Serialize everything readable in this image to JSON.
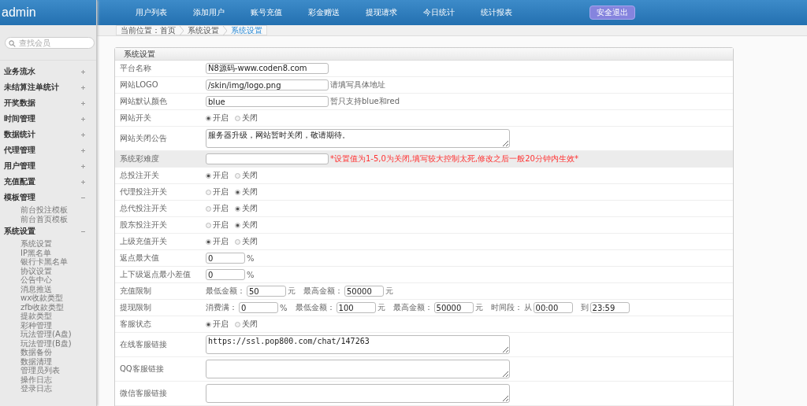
{
  "header": {
    "brand": "admin",
    "nav": [
      "用户列表",
      "添加用户",
      "账号充值",
      "彩金赠送",
      "提现请求",
      "今日统计",
      "统计报表"
    ],
    "logout": "安全退出"
  },
  "breadcrumb": [
    {
      "label": "当前位置：首页",
      "current": false
    },
    {
      "label": "系统设置",
      "current": false
    },
    {
      "label": "系统设置",
      "current": true
    }
  ],
  "sidebar": {
    "search": {
      "placeholder": "查找会员"
    },
    "groups": [
      {
        "label": "业务流水",
        "expanded": false
      },
      {
        "label": "未结算注单统计",
        "expanded": false
      },
      {
        "label": "开奖数据",
        "expanded": false
      },
      {
        "label": "时间管理",
        "expanded": false
      },
      {
        "label": "数据统计",
        "expanded": false
      },
      {
        "label": "代理管理",
        "expanded": false
      },
      {
        "label": "用户管理",
        "expanded": false
      },
      {
        "label": "充值配置",
        "expanded": false
      },
      {
        "label": "模板管理",
        "expanded": true,
        "children": [
          "前台投注模板",
          "前台首页模板"
        ]
      },
      {
        "label": "系统设置",
        "expanded": true,
        "children": [
          "系统设置",
          "IP黑名单",
          "银行卡黑名单",
          "协议设置",
          "公告中心",
          "消息推送",
          "wx收款类型",
          "zfb收款类型",
          "提款类型",
          "彩种管理",
          "玩法管理(A盘)",
          "玩法管理(B盘)",
          "数据备份",
          "数据清理",
          "管理员列表",
          "操作日志",
          "登录日志"
        ]
      }
    ]
  },
  "panel": {
    "title": "系统设置",
    "rows": [
      {
        "kind": "input",
        "label": "平台名称",
        "highlighted": false,
        "value": "N8源码-www.coden8.com"
      },
      {
        "kind": "input",
        "label": "网站LOGO",
        "highlighted": false,
        "value": "/skin/img/logo.png",
        "note": {
          "text": "请填写具体地址",
          "warning": false
        }
      },
      {
        "kind": "input",
        "label": "网站默认颜色",
        "highlighted": false,
        "value": "blue",
        "note": {
          "text": "暂只支持blue和red",
          "warning": false
        }
      },
      {
        "kind": "radio",
        "label": "网站开关",
        "highlighted": false,
        "options": [
          {
            "label": "开启",
            "selected": true
          },
          {
            "label": "关闭",
            "selected": false
          }
        ]
      },
      {
        "kind": "textarea",
        "label": "网站关闭公告",
        "highlighted": false,
        "value": "服务器升级，网站暂时关闭，敬请期待。"
      },
      {
        "kind": "input",
        "label": "系统彩难度",
        "highlighted": true,
        "value": "",
        "note": {
          "text": "*设置值为1-5,0为关闭,填写较大控制太死,修改之后一般20分钟内生效*",
          "warning": true
        }
      },
      {
        "kind": "radio",
        "label": "总投注开关",
        "highlighted": false,
        "options": [
          {
            "label": "开启",
            "selected": true
          },
          {
            "label": "关闭",
            "selected": false
          }
        ]
      },
      {
        "kind": "radio",
        "label": "代理投注开关",
        "highlighted": false,
        "options": [
          {
            "label": "开启",
            "selected": false
          },
          {
            "label": "关闭",
            "selected": true
          }
        ]
      },
      {
        "kind": "radio",
        "label": "总代投注开关",
        "highlighted": false,
        "options": [
          {
            "label": "开启",
            "selected": false
          },
          {
            "label": "关闭",
            "selected": true
          }
        ]
      },
      {
        "kind": "radio",
        "label": "股东投注开关",
        "highlighted": false,
        "options": [
          {
            "label": "开启",
            "selected": false
          },
          {
            "label": "关闭",
            "selected": true
          }
        ]
      },
      {
        "kind": "radio",
        "label": "上级充值开关",
        "highlighted": false,
        "options": [
          {
            "label": "开启",
            "selected": true
          },
          {
            "label": "关闭",
            "selected": false
          }
        ]
      },
      {
        "kind": "parts",
        "label": "返点最大值",
        "highlighted": false,
        "parts": [
          {
            "value": "0",
            "unit": "%"
          }
        ]
      },
      {
        "kind": "parts",
        "label": "上下级返点最小差值",
        "highlighted": false,
        "parts": [
          {
            "value": "0",
            "unit": "%"
          }
        ]
      },
      {
        "kind": "parts",
        "label": "充值限制",
        "highlighted": false,
        "parts": [
          {
            "prefix": "最低金额：",
            "value": "50",
            "unit": "元"
          },
          {
            "prefix": "最高金额：",
            "value": "50000",
            "unit": "元"
          }
        ]
      },
      {
        "kind": "parts",
        "label": "提现限制",
        "highlighted": false,
        "parts": [
          {
            "prefix": "消费满：",
            "value": "0",
            "unit": "%"
          },
          {
            "prefix": "最低金额：",
            "value": "100",
            "unit": "元"
          },
          {
            "prefix": "最高金额：",
            "value": "50000",
            "unit": "元"
          },
          {
            "prefix": "时间段：",
            "lead": "从",
            "value": "00:00"
          },
          {
            "prefix": "到",
            "value": "23:59"
          }
        ]
      },
      {
        "kind": "radio",
        "label": "客服状态",
        "highlighted": false,
        "options": [
          {
            "label": "开启",
            "selected": true
          },
          {
            "label": "关闭",
            "selected": false
          }
        ]
      },
      {
        "kind": "textarea",
        "label": "在线客服链接",
        "highlighted": false,
        "value": "https://ssl.pop800.com/chat/147263"
      },
      {
        "kind": "textarea",
        "label": "QQ客服链接",
        "highlighted": false,
        "value": ""
      },
      {
        "kind": "textarea",
        "label": "微信客服链接",
        "highlighted": false,
        "value": ""
      }
    ]
  }
}
